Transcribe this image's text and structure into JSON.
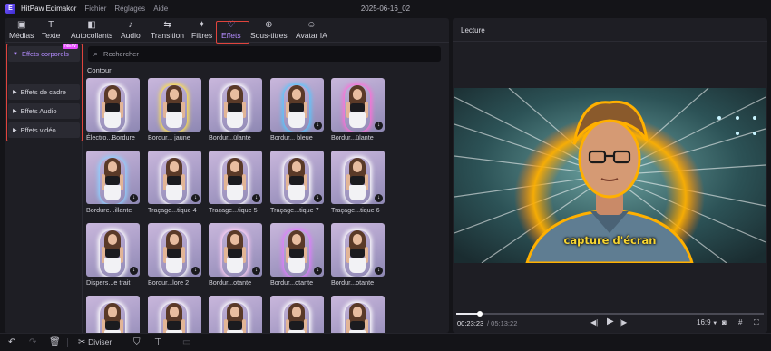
{
  "app": {
    "name": "HitPaw Edimakor",
    "logo_letter": "E",
    "menus": [
      "Fichier",
      "Réglages",
      "Aide"
    ],
    "project_title": "2025-06-16_02"
  },
  "toolbar": {
    "tabs": [
      {
        "label": "Médias",
        "icon": "media-icon",
        "glyph": "▣"
      },
      {
        "label": "Texte",
        "icon": "text-icon",
        "glyph": "T"
      },
      {
        "label": "Autocollants",
        "icon": "sticker-icon",
        "glyph": "◧"
      },
      {
        "label": "Audio",
        "icon": "audio-icon",
        "glyph": "♪"
      },
      {
        "label": "Transition",
        "icon": "transition-icon",
        "glyph": "⇆"
      },
      {
        "label": "Filtres",
        "icon": "filter-icon",
        "glyph": "✦"
      },
      {
        "label": "Effets",
        "icon": "effects-icon",
        "glyph": "♡"
      },
      {
        "label": "Sous-titres",
        "icon": "subtitle-icon",
        "glyph": "⊕"
      },
      {
        "label": "Avatar IA",
        "icon": "avatar-ai-icon",
        "glyph": "☺"
      }
    ],
    "active": "Effets"
  },
  "categories": {
    "items": [
      {
        "label": "Effets corporels",
        "open": true,
        "badge": "NEW"
      },
      {
        "label": "Effets de cadre",
        "open": false
      },
      {
        "label": "Effets Audio",
        "open": false
      },
      {
        "label": "Effets vidéo",
        "open": false
      }
    ],
    "subitem": "Contour"
  },
  "search": {
    "placeholder": "Rechercher"
  },
  "section": {
    "label": "Contour"
  },
  "effects": [
    {
      "label": "Électro...Bordure",
      "glow": "#ffffff",
      "download": false
    },
    {
      "label": "Bordur... jaune",
      "glow": "#ffe34a",
      "download": false
    },
    {
      "label": "Bordur...ülante",
      "glow": "#ffffff",
      "download": false
    },
    {
      "label": "Bordur... bleue",
      "glow": "#56c8ff",
      "download": true
    },
    {
      "label": "Bordur...ülante",
      "glow": "#ff6fd8",
      "download": true
    },
    {
      "label": "Bordure...illante",
      "glow": "#8fd0ff",
      "download": true
    },
    {
      "label": "Traçage...tique 4",
      "glow": "#ffffff",
      "download": true
    },
    {
      "label": "Traçage...tique 5",
      "glow": "#ffffff",
      "download": true
    },
    {
      "label": "Traçage...tique 7",
      "glow": "#ffffff",
      "download": true
    },
    {
      "label": "Traçage...tique 6",
      "glow": "#ffffff",
      "download": true
    },
    {
      "label": "Dispers...e trait",
      "glow": "#ffffff",
      "download": true
    },
    {
      "label": "Bordur...lore 2",
      "glow": "#ffffff",
      "download": true
    },
    {
      "label": "Bordur...otante",
      "glow": "#ffd1f5",
      "download": true
    },
    {
      "label": "Bordur...otante",
      "glow": "#e07cff",
      "download": true
    },
    {
      "label": "Bordur...otante",
      "glow": "#ffffff",
      "download": true
    },
    {
      "label": "",
      "glow": "#ffffff",
      "download": false
    },
    {
      "label": "",
      "glow": "#ffffff",
      "download": false
    },
    {
      "label": "",
      "glow": "#ffffff",
      "download": false
    },
    {
      "label": "",
      "glow": "#ffffff",
      "download": false
    },
    {
      "label": "",
      "glow": "#ffffff",
      "download": false
    }
  ],
  "preview": {
    "title": "Lecture",
    "caption": "capture d'écran",
    "time_current": "00:23:23",
    "time_total": "/ 05:13:22",
    "progress_fraction": 0.077,
    "aspect": "16:9",
    "aspect_icon": "chevron-down-icon",
    "controls": [
      "prev-frame-icon",
      "play-icon",
      "next-frame-icon"
    ]
  },
  "bottom": {
    "split_label": "Diviser"
  }
}
